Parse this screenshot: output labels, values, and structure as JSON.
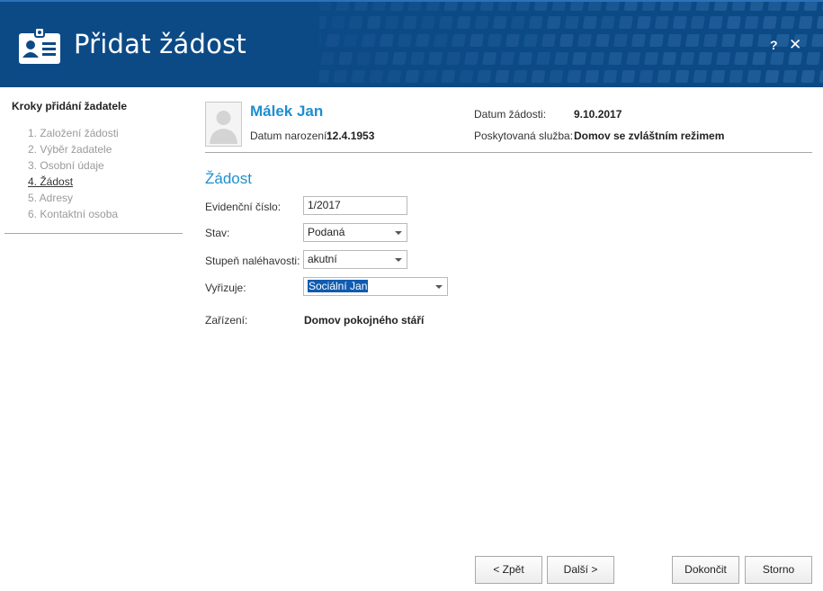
{
  "header": {
    "title": "Přidat žádost",
    "help_label": "?",
    "close_label": "✕",
    "icon": "id-card-icon"
  },
  "sidebar": {
    "title": "Kroky přidání žadatele",
    "steps": [
      {
        "label": "1. Založení žádosti",
        "active": false
      },
      {
        "label": "2. Výběr žadatele",
        "active": false
      },
      {
        "label": "3. Osobní údaje",
        "active": false
      },
      {
        "label": "4. Žádost",
        "active": true
      },
      {
        "label": "5. Adresy",
        "active": false
      },
      {
        "label": "6. Kontaktní osoba",
        "active": false
      }
    ]
  },
  "person": {
    "name": "Málek Jan",
    "birth_label": "Datum narození:",
    "birth_value": "12.4.1953",
    "request_date_label": "Datum žádosti:",
    "request_date_value": "9.10.2017",
    "service_label": "Poskytovaná služba:",
    "service_value": "Domov se zvláštním režimem"
  },
  "form": {
    "section_title": "Žádost",
    "evidence_label": "Evidenční číslo:",
    "evidence_value": "1/2017",
    "status_label": "Stav:",
    "status_value": "Podaná",
    "urgency_label": "Stupeň naléhavosti:",
    "urgency_value": "akutní",
    "handler_label": "Vyřizuje:",
    "handler_value": "Sociální Jan",
    "facility_label": "Zařízení:",
    "facility_value": "Domov pokojného stáří"
  },
  "buttons": {
    "back": "< Zpět",
    "next": "Další >",
    "finish": "Dokončit",
    "cancel": "Storno"
  },
  "colors": {
    "header_bg": "#0c4a86",
    "accent": "#1d8fd0",
    "selection": "#0f5bb0"
  }
}
